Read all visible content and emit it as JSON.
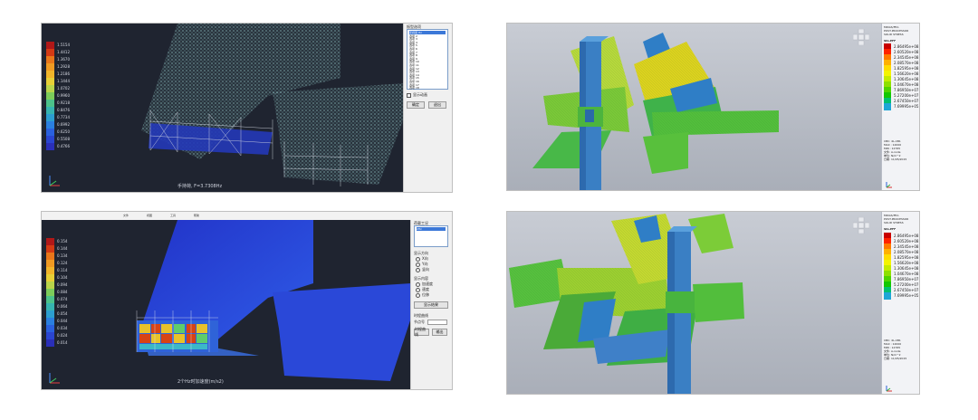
{
  "panels": {
    "top_left": {
      "caption": "手持荷, F=3.7308Hz",
      "legend": [
        {
          "label": "1.5154",
          "color": "#b01818"
        },
        {
          "label": "1.4412",
          "color": "#d43a14"
        },
        {
          "label": "1.3670",
          "color": "#e8761a"
        },
        {
          "label": "1.2928",
          "color": "#ef9a22"
        },
        {
          "label": "1.2186",
          "color": "#f0b52a"
        },
        {
          "label": "1.1444",
          "color": "#e6cf36"
        },
        {
          "label": "1.0702",
          "color": "#b9d44a"
        },
        {
          "label": "0.9960",
          "color": "#7ccc5a"
        },
        {
          "label": "0.9218",
          "color": "#4cc28a"
        },
        {
          "label": "0.8476",
          "color": "#36b4b0"
        },
        {
          "label": "0.7734",
          "color": "#2c9ed0"
        },
        {
          "label": "0.6992",
          "color": "#2a7fe0"
        },
        {
          "label": "0.6250",
          "color": "#2a60de"
        },
        {
          "label": "0.5508",
          "color": "#2a45d0"
        },
        {
          "label": "0.4766",
          "color": "#2a2fb8"
        }
      ],
      "side_title": "振型选项",
      "list_items": [
        "手持荷 Hz",
        "选项 2",
        "选项 3",
        "选项 4",
        "选项 5",
        "选项 6",
        "选项 7",
        "选项 8",
        "选项 9",
        "选项 10",
        "选项 11",
        "选项 12",
        "选项 13",
        "选项 14",
        "选项 15",
        "选项 16",
        "选项 17",
        "选项 18"
      ],
      "check_label": "显示动画",
      "ok_label": "确定",
      "cancel_label": "退出"
    },
    "bottom_left": {
      "caption": "2个Hz时加速度(m/s2)",
      "legend": [
        {
          "label": "0.154",
          "color": "#b01818"
        },
        {
          "label": "0.144",
          "color": "#d43a14"
        },
        {
          "label": "0.134",
          "color": "#e8761a"
        },
        {
          "label": "0.124",
          "color": "#ef9a22"
        },
        {
          "label": "0.114",
          "color": "#f0b52a"
        },
        {
          "label": "0.104",
          "color": "#e6cf36"
        },
        {
          "label": "0.094",
          "color": "#b9d44a"
        },
        {
          "label": "0.084",
          "color": "#7ccc5a"
        },
        {
          "label": "0.074",
          "color": "#4cc28a"
        },
        {
          "label": "0.064",
          "color": "#36b4b0"
        },
        {
          "label": "0.054",
          "color": "#2c9ed0"
        },
        {
          "label": "0.044",
          "color": "#2a7fe0"
        },
        {
          "label": "0.034",
          "color": "#2a60de"
        },
        {
          "label": "0.024",
          "color": "#2a45d0"
        },
        {
          "label": "0.014",
          "color": "#2a2fb8"
        }
      ],
      "toolbar_items": [
        "文件",
        "视图",
        "工具",
        "帮助"
      ],
      "side_title": "荷载工况",
      "list_items": [
        "2Hz"
      ],
      "group1_title": "显示方向",
      "radios1": [
        "X向",
        "Y向",
        "竖向"
      ],
      "group2_title": "显示内容",
      "radios2": [
        "加速度",
        "速度",
        "位移"
      ],
      "button1": "显示结果",
      "group3_title": "时程曲线",
      "button2": "时程曲线",
      "button3": "输出",
      "input_label": "节点号"
    },
    "top_right": {
      "header": [
        "MIDAS/FEA",
        "POST-PROCESSOR",
        "SOLID STRESS"
      ],
      "legend_title": "SIG-EFF",
      "legend": [
        {
          "label": "2.86495e+08",
          "color": "#c80000"
        },
        {
          "label": "2.60520e+08",
          "color": "#ff2200"
        },
        {
          "label": "2.34545e+08",
          "color": "#ff7a00"
        },
        {
          "label": "2.08570e+08",
          "color": "#ffb000"
        },
        {
          "label": "1.82595e+08",
          "color": "#ffdc00"
        },
        {
          "label": "1.56620e+08",
          "color": "#f4f400"
        },
        {
          "label": "1.30645e+08",
          "color": "#c4ec00"
        },
        {
          "label": "1.04670e+08",
          "color": "#8ee000"
        },
        {
          "label": "7.86950e+07",
          "color": "#4ed400"
        },
        {
          "label": "5.27200e+07",
          "color": "#12c800"
        },
        {
          "label": "2.67450e+07",
          "color": "#00c070"
        },
        {
          "label": "7.69995e+05",
          "color": "#1ea6d6"
        }
      ],
      "footer": [
        "CBC: 4L-CB1",
        "MAX : 12000",
        "MIN : 12765",
        "文件: A-node",
        "单位: N/m^2",
        "日期: 11/05/2015"
      ]
    },
    "bottom_right": {
      "header": [
        "MIDAS/FEA",
        "POST-PROCESSOR",
        "SOLID STRESS"
      ],
      "legend_title": "SIG-EFF",
      "legend": [
        {
          "label": "2.86495e+08",
          "color": "#c80000"
        },
        {
          "label": "2.60520e+08",
          "color": "#ff2200"
        },
        {
          "label": "2.34545e+08",
          "color": "#ff7a00"
        },
        {
          "label": "2.08570e+08",
          "color": "#ffb000"
        },
        {
          "label": "1.82595e+08",
          "color": "#ffdc00"
        },
        {
          "label": "1.56620e+08",
          "color": "#f4f400"
        },
        {
          "label": "1.30645e+08",
          "color": "#c4ec00"
        },
        {
          "label": "1.04670e+08",
          "color": "#8ee000"
        },
        {
          "label": "7.86950e+07",
          "color": "#4ed400"
        },
        {
          "label": "5.27200e+07",
          "color": "#12c800"
        },
        {
          "label": "2.67450e+07",
          "color": "#00c070"
        },
        {
          "label": "7.69995e+05",
          "color": "#1ea6d6"
        }
      ],
      "footer": [
        "CBC: 4L-CB1",
        "MAX : 12000",
        "MIN : 12765",
        "文件: A-node",
        "单位: N/m^2",
        "日期: 11/05/2015"
      ]
    }
  }
}
